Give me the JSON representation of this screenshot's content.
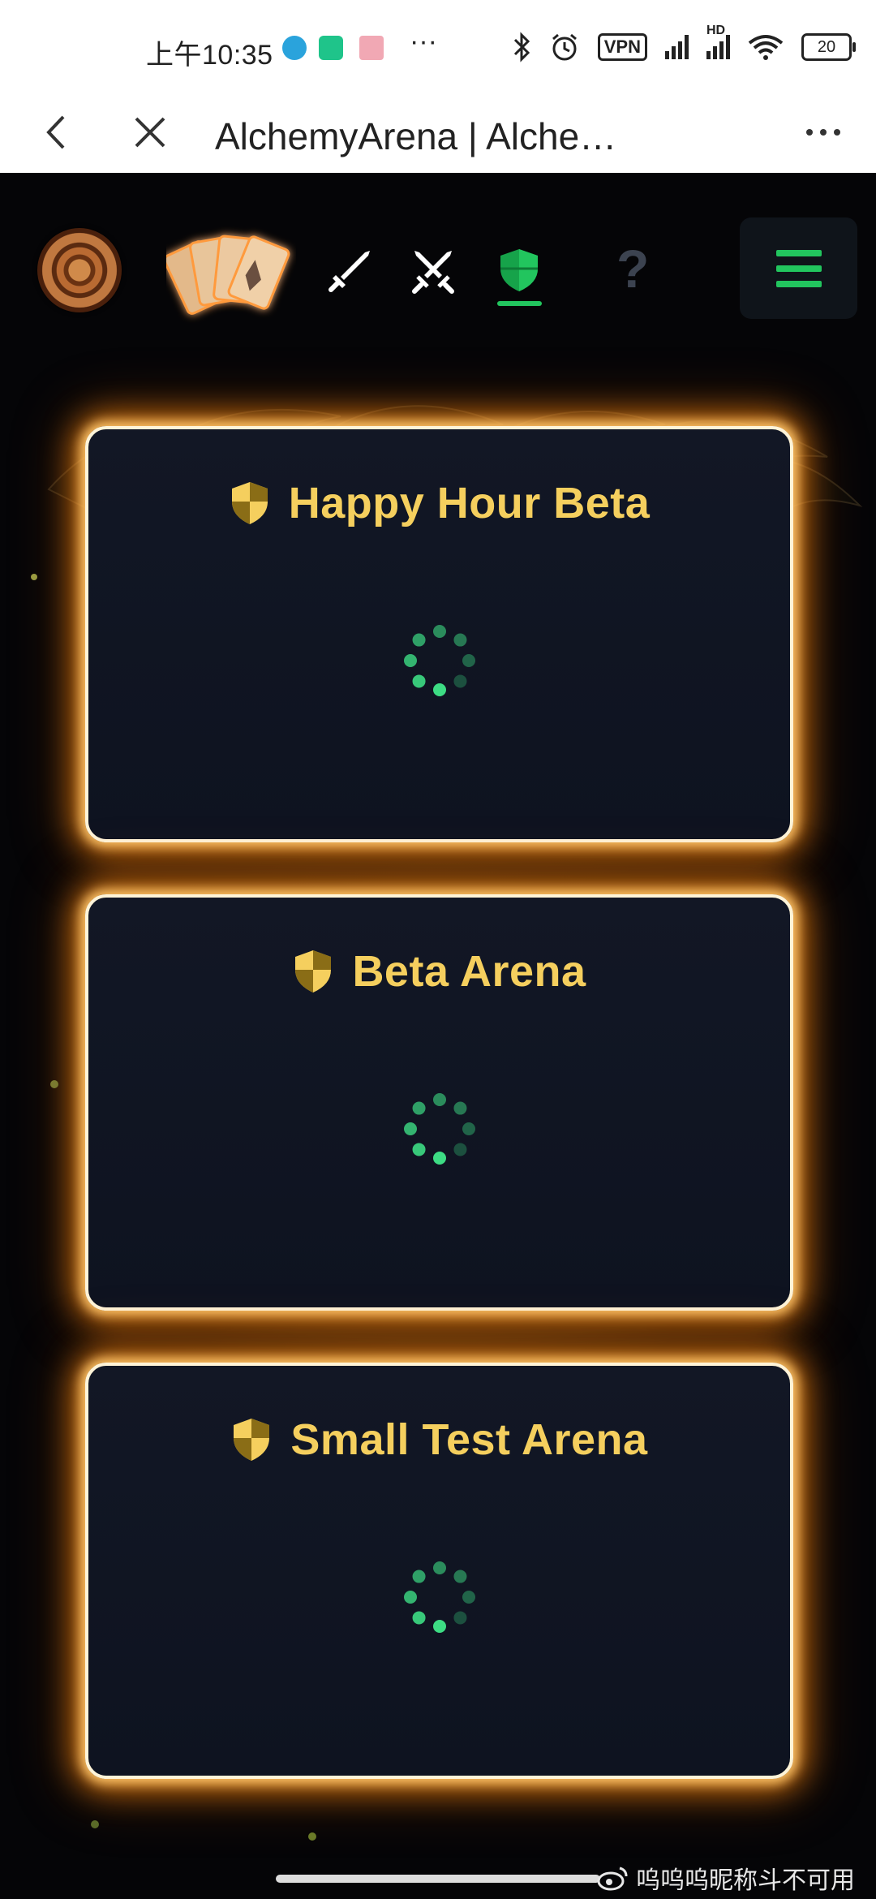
{
  "status_bar": {
    "time": "上午10:35",
    "dots": "···",
    "vpn": "VPN",
    "hd": "HD",
    "battery": "20"
  },
  "browser": {
    "title": "AlchemyArena | Alche…"
  },
  "nav": {
    "items": [
      "logo",
      "cards",
      "sword",
      "crossed-swords",
      "shield",
      "help",
      "menu"
    ],
    "active": "shield",
    "help_glyph": "?",
    "accent_color": "#22c55e"
  },
  "arenas": [
    {
      "name": "Happy Hour Beta"
    },
    {
      "name": "Beta Arena"
    },
    {
      "name": "Small Test Arena"
    }
  ],
  "colors": {
    "title_gold": "#f5cf5e",
    "glow_orange": "#ff8c14",
    "card_bg": "#121725",
    "spinner_green": "#3ddc84"
  },
  "watermark": {
    "text": "呜呜呜昵称斗不可用"
  }
}
